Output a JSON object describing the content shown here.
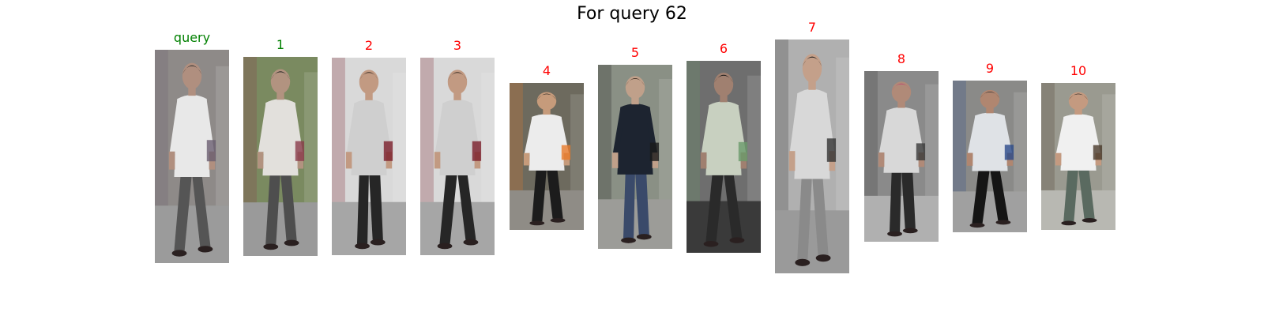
{
  "title": "For query 62",
  "colors": {
    "match": "#008000",
    "nonmatch": "#ff0000",
    "title": "#000000"
  },
  "panels": [
    {
      "label": "query",
      "status": "match",
      "image": {
        "bg": "#8e8a88",
        "ground": "#9b9b9b",
        "shirt": "#e8e8e8",
        "pants": "#555555",
        "hair": "#2a2a2a",
        "skin": "#b08f7f",
        "accent": "#6a5e70"
      }
    },
    {
      "label": "1",
      "status": "match",
      "image": {
        "bg": "#7a8a60",
        "ground": "#9a9a9a",
        "shirt": "#e2e0dc",
        "pants": "#4e4e4e",
        "hair": "#1e1e1e",
        "skin": "#b29380",
        "accent": "#8a3b4a"
      }
    },
    {
      "label": "2",
      "status": "nonmatch",
      "image": {
        "bg": "#d9d9d9",
        "ground": "#a6a6a6",
        "shirt": "#cfcfcf",
        "pants": "#262626",
        "hair": "#3a2e25",
        "skin": "#c29a82",
        "accent": "#7a1e2a"
      }
    },
    {
      "label": "3",
      "status": "nonmatch",
      "image": {
        "bg": "#d9d9d9",
        "ground": "#a6a6a6",
        "shirt": "#cfcfcf",
        "pants": "#262626",
        "hair": "#3a2e25",
        "skin": "#c29a82",
        "accent": "#7a1e2a"
      }
    },
    {
      "label": "4",
      "status": "nonmatch",
      "image": {
        "bg": "#6d6a5e",
        "ground": "#8f8c86",
        "shirt": "#ececec",
        "pants": "#1c1c1c",
        "hair": "#1a1a1a",
        "skin": "#c69b7b",
        "accent": "#e87a2a"
      }
    },
    {
      "label": "5",
      "status": "nonmatch",
      "image": {
        "bg": "#8a9085",
        "ground": "#9c9c98",
        "shirt": "#1d2430",
        "pants": "#3a4a6a",
        "hair": "#3b2b20",
        "skin": "#c0a08a",
        "accent": "#1a1a1a"
      }
    },
    {
      "label": "6",
      "status": "nonmatch",
      "image": {
        "bg": "#6e6e6e",
        "ground": "#3a3a3a",
        "shirt": "#c8d0c0",
        "pants": "#2a2a2a",
        "hair": "#151515",
        "skin": "#a08070",
        "accent": "#6a9a6a"
      }
    },
    {
      "label": "7",
      "status": "nonmatch",
      "image": {
        "bg": "#b0b0b0",
        "ground": "#9a9a9a",
        "shirt": "#d8d8d8",
        "pants": "#8a8a8a",
        "hair": "#1a1a1a",
        "skin": "#c4a08a",
        "accent": "#333333"
      }
    },
    {
      "label": "8",
      "status": "nonmatch",
      "image": {
        "bg": "#8a8a8a",
        "ground": "#b0b0b0",
        "shirt": "#d8d8d8",
        "pants": "#2a2a2a",
        "hair": "#c04070",
        "skin": "#b08a78",
        "accent": "#3a3a3a"
      }
    },
    {
      "label": "9",
      "status": "nonmatch",
      "image": {
        "bg": "#8a8a88",
        "ground": "#a0a0a0",
        "shirt": "#dfe2e6",
        "pants": "#151515",
        "hair": "#2a2a2a",
        "skin": "#b08670",
        "accent": "#2a4a8a"
      }
    },
    {
      "label": "10",
      "status": "nonmatch",
      "image": {
        "bg": "#9a9a90",
        "ground": "#b8b8b2",
        "shirt": "#f0f0f0",
        "pants": "#5a6a60",
        "hair": "#1a1a1a",
        "skin": "#c49a80",
        "accent": "#4a3a2a"
      }
    }
  ]
}
